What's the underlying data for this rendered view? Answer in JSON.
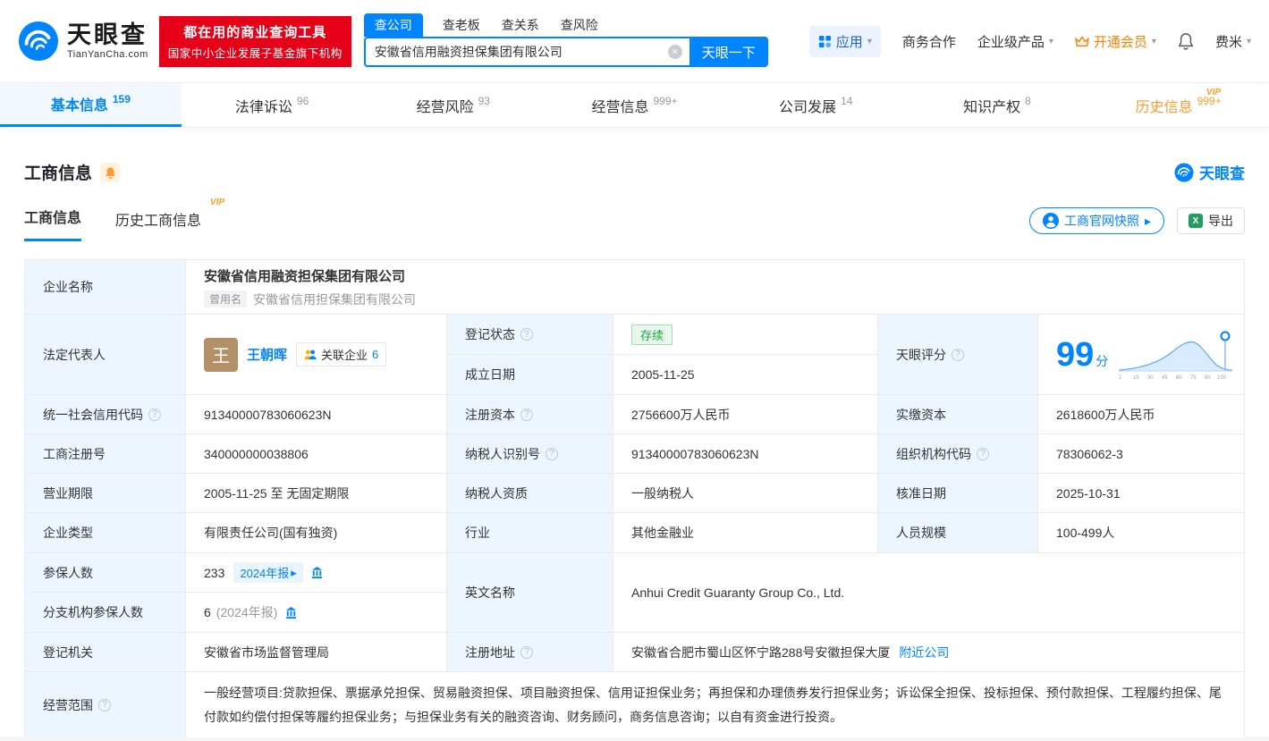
{
  "vip_label": "VIP",
  "icons": {
    "help": "?",
    "caret": "▾",
    "arrow": "▸",
    "clear": "✕",
    "excel": "X"
  },
  "colors": {
    "accent": "#0084ff",
    "orange": "#ff9a2e",
    "red": "#e60018",
    "green": "#20a53a",
    "label_bg": "#edf6fe"
  },
  "header": {
    "brand": "天眼查",
    "domain": "TianYanCha.com",
    "promo_line1": "都在用的商业查询工具",
    "promo_line2": "国家中小企业发展子基金旗下机构",
    "search_tabs": [
      {
        "label": "查公司",
        "active": true
      },
      {
        "label": "查老板",
        "active": false
      },
      {
        "label": "查关系",
        "active": false
      },
      {
        "label": "查风险",
        "active": false
      }
    ],
    "search_value": "安徽省信用融资担保集团有限公司",
    "search_button": "天眼一下",
    "menu": {
      "apps": "应用",
      "cooperation": "商务合作",
      "enterprise": "企业级产品",
      "vip": "开通会员",
      "user": "费米"
    }
  },
  "nav_tabs": [
    {
      "label": "基本信息",
      "count": "159"
    },
    {
      "label": "法律诉讼",
      "count": "96"
    },
    {
      "label": "经营风险",
      "count": "93"
    },
    {
      "label": "经营信息",
      "count": "999+"
    },
    {
      "label": "公司发展",
      "count": "14"
    },
    {
      "label": "知识产权",
      "count": "8"
    },
    {
      "label": "历史信息",
      "count": "999+"
    }
  ],
  "section": {
    "title": "工商信息",
    "brand": "天眼查",
    "tab_current": "工商信息",
    "tab_history": "历史工商信息",
    "snapshot_button": "工商官网快照",
    "export_button": "导出"
  },
  "info": {
    "company_name_label": "企业名称",
    "company_name": "安徽省信用融资担保集团有限公司",
    "former_name_tag": "曾用名",
    "former_name": "安徽省信用担保集团有限公司",
    "legal_rep_label": "法定代表人",
    "legal_rep_avatar": "王",
    "legal_rep_name": "王朝晖",
    "related_companies_label": "关联企业",
    "related_companies_count": "6",
    "reg_status_label": "登记状态",
    "reg_status": "存续",
    "establish_date_label": "成立日期",
    "establish_date": "2005-11-25",
    "score_label": "天眼评分",
    "score_value": "99",
    "score_unit": "分",
    "score_axis": [
      "1",
      "15",
      "30",
      "45",
      "60",
      "75",
      "90",
      "100"
    ],
    "credit_code_label": "统一社会信用代码",
    "credit_code": "91340000783060623N",
    "reg_capital_label": "注册资本",
    "reg_capital": "2756600万人民币",
    "paid_capital_label": "实缴资本",
    "paid_capital": "2618600万人民币",
    "reg_number_label": "工商注册号",
    "reg_number": "340000000038806",
    "taxpayer_id_label": "纳税人识别号",
    "taxpayer_id": "91340000783060623N",
    "org_code_label": "组织机构代码",
    "org_code": "78306062-3",
    "business_term_label": "营业期限",
    "business_term": "2005-11-25 至 无固定期限",
    "taxpayer_quality_label": "纳税人资质",
    "taxpayer_quality": "一般纳税人",
    "approve_date_label": "核准日期",
    "approve_date": "2025-10-31",
    "company_type_label": "企业类型",
    "company_type": "有限责任公司(国有独资)",
    "industry_label": "行业",
    "industry": "其他金融业",
    "staff_size_label": "人员规模",
    "staff_size": "100-499人",
    "insured_label": "参保人数",
    "insured_count": "233",
    "insured_report_tag": "2024年报",
    "english_name_label": "英文名称",
    "english_name": "Anhui Credit Guaranty Group Co., Ltd.",
    "branch_insured_label": "分支机构参保人数",
    "branch_insured_count": "6",
    "branch_insured_note": "(2024年报)",
    "reg_authority_label": "登记机关",
    "reg_authority": "安徽省市场监督管理局",
    "address_label": "注册地址",
    "address": "安徽省合肥市蜀山区怀宁路288号安徽担保大厦",
    "nearby_link": "附近公司",
    "business_scope_label": "经营范围",
    "business_scope": "一般经营项目:贷款担保、票据承兑担保、贸易融资担保、项目融资担保、信用证担保业务；再担保和办理债券发行担保业务；诉讼保全担保、投标担保、预付款担保、工程履约担保、尾付款如约偿付担保等履约担保业务；与担保业务有关的融资咨询、财务顾问，商务信息咨询；以自有资金进行投资。"
  }
}
